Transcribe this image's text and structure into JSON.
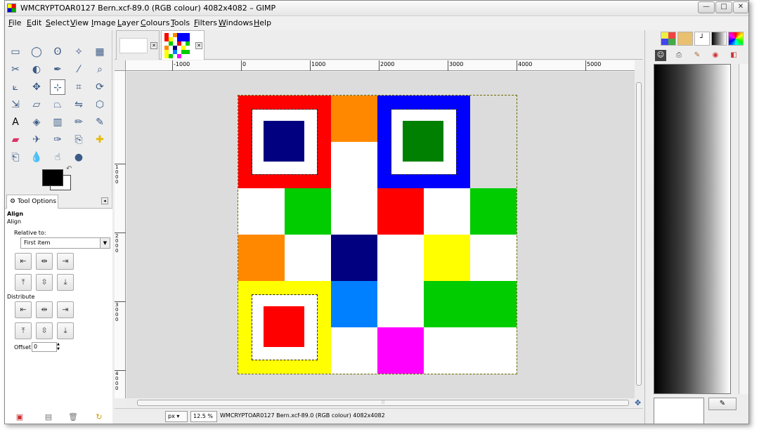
{
  "window": {
    "title": "WMCRYPTOAR0127 Bern.xcf-89.0 (RGB colour) 4082x4082 – GIMP",
    "controls": {
      "minimize": "—",
      "maximize": "□",
      "close": "✕"
    }
  },
  "menubar": [
    "File",
    "Edit",
    "Select",
    "View",
    "Image",
    "Layer",
    "Colours",
    "Tools",
    "Filters",
    "Windows",
    "Help"
  ],
  "toolbox": {
    "tool_icons": [
      "rect-select",
      "ellipse-select",
      "free-select",
      "fuzzy-select",
      "select-by-color",
      "scissors",
      "foreground-select",
      "paths",
      "color-picker",
      "zoom",
      "measure",
      "move",
      "align",
      "crop",
      "rotate",
      "scale",
      "shear",
      "perspective",
      "flip",
      "cage",
      "text",
      "bucket-fill",
      "blend",
      "pencil",
      "paintbrush",
      "eraser",
      "airbrush",
      "ink",
      "clone",
      "heal",
      "perspective-clone",
      "blur",
      "smudge",
      "dodge-burn"
    ],
    "active_tool": "align"
  },
  "tool_options": {
    "tab_label": "Tool Options",
    "heading": "Align",
    "sub_heading": "Align",
    "relative_to_label": "Relative to:",
    "relative_to_value": "First item",
    "distribute_label": "Distribute",
    "offset_label": "Offset:",
    "offset_value": "0"
  },
  "image_tabs": [
    {
      "name": "blank-image-tab",
      "active": false
    },
    {
      "name": "wmcryptoar0127-bern-tab",
      "active": true
    }
  ],
  "rulers": {
    "horizontal_labels": [
      "-1000",
      "0",
      "1000",
      "2000",
      "3000",
      "4000",
      "5000"
    ],
    "vertical_labels": [
      "1000",
      "2000",
      "3000",
      "4000"
    ]
  },
  "canvas": {
    "grid": [
      [
        "frame-red",
        "white",
        "orange",
        "frame-blue",
        "frame-blue",
        "frame-blue"
      ],
      [
        "frame-red",
        "yellow",
        "white",
        "frame-blue",
        "frame-blue",
        "frame-blue"
      ],
      [
        "white",
        "green",
        "white",
        "red",
        "white",
        "green"
      ],
      [
        "orange",
        "white",
        "navy",
        "white",
        "yellow",
        "white"
      ],
      [
        "frame-yellow",
        "white",
        "azure",
        "white",
        "green",
        "green"
      ],
      [
        "frame-yellow",
        "green",
        "white",
        "magenta",
        "white",
        "white"
      ]
    ],
    "frames": {
      "red": {
        "outer": "#ff0000",
        "core": "#000080"
      },
      "blue": {
        "outer": "#0000ff",
        "core": "#008000"
      },
      "yellow": {
        "outer": "#ffff00",
        "core": "#ff0000"
      }
    },
    "colors": {
      "white": "#ffffff",
      "orange": "#ff8800",
      "yellow": "#ffff00",
      "green": "#00cc00",
      "red": "#ff0000",
      "navy": "#000080",
      "azure": "#0080ff",
      "magenta": "#ff00ff"
    }
  },
  "statusbar": {
    "unit": "px",
    "zoom": "12.5 %",
    "text": "WMCRYPTOAR0127 Bern.xcf-89.0 (RGB colour) 4082x4082"
  },
  "dock": {
    "tabs": [
      "brushes",
      "patterns",
      "fonts",
      "gradients",
      "palettes"
    ],
    "icons": [
      "gimp-icon",
      "printer-icon",
      "brush-icon",
      "palette-icon",
      "colors-icon",
      "gradient-icon"
    ]
  }
}
